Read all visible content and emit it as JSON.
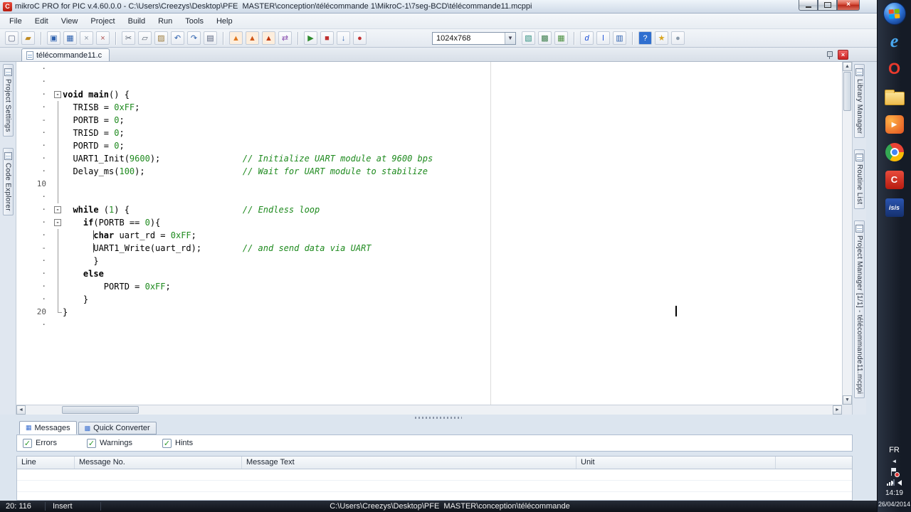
{
  "window": {
    "title": "mikroC PRO for PIC v.4.60.0.0 - C:\\Users\\Creezys\\Desktop\\PFE  MASTER\\conception\\télécommande 1\\MikroC-1\\7seg-BCD\\télécommande11.mcppi"
  },
  "menus": [
    "File",
    "Edit",
    "View",
    "Project",
    "Build",
    "Run",
    "Tools",
    "Help"
  ],
  "toolbar": {
    "resolution": "1024x768",
    "groups_left": [
      [
        {
          "name": "new-file",
          "glyph": "▢",
          "fg": "#55607a"
        },
        {
          "name": "open-file",
          "glyph": "▰",
          "fg": "#c08a20"
        }
      ],
      [
        {
          "name": "save-file",
          "glyph": "▣",
          "fg": "#2b5fad"
        },
        {
          "name": "save-all",
          "glyph": "▦",
          "fg": "#2b5fad"
        },
        {
          "name": "close-file",
          "glyph": "×",
          "fg": "#8a95a5"
        },
        {
          "name": "close-all",
          "glyph": "×",
          "fg": "#b05050"
        }
      ],
      [
        {
          "name": "cut",
          "glyph": "✂",
          "fg": "#555f6e"
        },
        {
          "name": "copy",
          "glyph": "▱",
          "fg": "#555f6e"
        },
        {
          "name": "paste",
          "glyph": "▨",
          "fg": "#9a7a3a"
        },
        {
          "name": "undo",
          "glyph": "↶",
          "fg": "#2b5fad"
        },
        {
          "name": "redo",
          "glyph": "↷",
          "fg": "#2b5fad"
        },
        {
          "name": "print",
          "glyph": "▤",
          "fg": "#55607a"
        }
      ],
      [
        {
          "name": "build",
          "glyph": "▲",
          "fg": "#e07820",
          "bg": "#fdeedd"
        },
        {
          "name": "rebuild",
          "glyph": "▲",
          "fg": "#d05818",
          "bg": "#fdeedd"
        },
        {
          "name": "build-and-program",
          "glyph": "▲",
          "fg": "#c03810",
          "bg": "#fdeedd"
        },
        {
          "name": "program",
          "glyph": "⇄",
          "fg": "#8a4fb0"
        }
      ],
      [
        {
          "name": "run-debugger",
          "glyph": "▶",
          "fg": "#2e8b2e"
        },
        {
          "name": "stop-debugger",
          "glyph": "■",
          "fg": "#c03030"
        },
        {
          "name": "step-into",
          "glyph": "↓",
          "fg": "#2b5fad"
        },
        {
          "name": "breakpoints",
          "glyph": "●",
          "fg": "#c03030"
        }
      ]
    ],
    "groups_right": [
      [
        {
          "name": "edit-project",
          "glyph": "▧",
          "fg": "#2f8f7f"
        },
        {
          "name": "clean-project",
          "glyph": "▩",
          "fg": "#3f7f4f"
        },
        {
          "name": "project-manager",
          "glyph": "▦",
          "fg": "#4a8f3f"
        }
      ],
      [
        {
          "name": "comment-lines",
          "glyph": "d",
          "fg": "#1b4fd8",
          "italic": true
        },
        {
          "name": "uncomment-lines",
          "glyph": "l",
          "fg": "#1b4fd8"
        },
        {
          "name": "code-templates",
          "glyph": "▥",
          "fg": "#2b5fad"
        }
      ],
      [
        {
          "name": "help",
          "glyph": "?",
          "fg": "#ffffff",
          "bg": "#2f6fd0"
        },
        {
          "name": "show-tips",
          "glyph": "★",
          "fg": "#d9a520"
        },
        {
          "name": "check-updates",
          "glyph": "●",
          "fg": "#8899aa"
        }
      ]
    ]
  },
  "document_tab": {
    "label": "télécommande11.c"
  },
  "side_left": [
    {
      "label": "Project Settings",
      "icon": "project-settings-icon"
    },
    {
      "label": "Code Explorer",
      "icon": "code-explorer-icon"
    }
  ],
  "side_right": [
    {
      "label": "Library Manager",
      "icon": "library-manager-icon"
    },
    {
      "label": "Routine List",
      "icon": "routine-list-icon"
    },
    {
      "label": "Project Manager [1/1] - télécommande11.mcppi",
      "icon": "project-manager-icon"
    }
  ],
  "editor": {
    "lines": [
      {
        "g": "·",
        "f": "",
        "t": []
      },
      {
        "g": "·",
        "f": "",
        "t": []
      },
      {
        "g": "·",
        "f": "box",
        "t": [
          {
            "c": "kw",
            "s": "void main"
          },
          {
            "c": "pl",
            "s": "() {"
          }
        ]
      },
      {
        "g": "·",
        "f": "ln",
        "t": [
          {
            "c": "pl",
            "s": "  TRISB = "
          },
          {
            "c": "num",
            "s": "0xFF"
          },
          {
            "c": "pl",
            "s": ";"
          }
        ]
      },
      {
        "g": "-",
        "f": "ln",
        "t": [
          {
            "c": "pl",
            "s": "  PORTB = "
          },
          {
            "c": "num",
            "s": "0"
          },
          {
            "c": "pl",
            "s": ";"
          }
        ]
      },
      {
        "g": "·",
        "f": "ln",
        "t": [
          {
            "c": "pl",
            "s": "  TRISD = "
          },
          {
            "c": "num",
            "s": "0"
          },
          {
            "c": "pl",
            "s": ";"
          }
        ]
      },
      {
        "g": "·",
        "f": "ln",
        "t": [
          {
            "c": "pl",
            "s": "  PORTD = "
          },
          {
            "c": "num",
            "s": "0"
          },
          {
            "c": "pl",
            "s": ";"
          }
        ]
      },
      {
        "g": "·",
        "f": "ln",
        "t": [
          {
            "c": "pl",
            "s": "  UART1_Init("
          },
          {
            "c": "num",
            "s": "9600"
          },
          {
            "c": "pl",
            "s": ");                "
          },
          {
            "c": "cm",
            "s": "// Initialize UART module at 9600 bps"
          }
        ]
      },
      {
        "g": "·",
        "f": "ln",
        "t": [
          {
            "c": "pl",
            "s": "  Delay_ms("
          },
          {
            "c": "num",
            "s": "100"
          },
          {
            "c": "pl",
            "s": ");                   "
          },
          {
            "c": "cm",
            "s": "// Wait for UART module to stabilize"
          }
        ]
      },
      {
        "g": "10",
        "f": "ln",
        "t": []
      },
      {
        "g": "·",
        "f": "ln",
        "t": []
      },
      {
        "g": "·",
        "f": "box",
        "t": [
          {
            "c": "pl",
            "s": "  "
          },
          {
            "c": "kw",
            "s": "while"
          },
          {
            "c": "pl",
            "s": " ("
          },
          {
            "c": "num",
            "s": "1"
          },
          {
            "c": "pl",
            "s": ") {                      "
          },
          {
            "c": "cm",
            "s": "// Endless loop"
          }
        ]
      },
      {
        "g": "·",
        "f": "box",
        "t": [
          {
            "c": "pl",
            "s": "    "
          },
          {
            "c": "kw",
            "s": "if"
          },
          {
            "c": "pl",
            "s": "(PORTB == "
          },
          {
            "c": "num",
            "s": "0"
          },
          {
            "c": "pl",
            "s": "){"
          }
        ]
      },
      {
        "g": "·",
        "f": "ln",
        "t": [
          {
            "c": "pl",
            "s": "      "
          },
          {
            "c": "gd",
            "s": ""
          },
          {
            "c": "kw",
            "s": "char"
          },
          {
            "c": "pl",
            "s": " uart_rd = "
          },
          {
            "c": "num",
            "s": "0xFF"
          },
          {
            "c": "pl",
            "s": ";"
          }
        ]
      },
      {
        "g": "-",
        "f": "ln",
        "t": [
          {
            "c": "pl",
            "s": "      "
          },
          {
            "c": "gd",
            "s": ""
          },
          {
            "c": "pl",
            "s": "UART1_Write(uart_rd);        "
          },
          {
            "c": "cm",
            "s": "// and send data via UART"
          }
        ]
      },
      {
        "g": "·",
        "f": "ln",
        "t": [
          {
            "c": "pl",
            "s": "      }"
          }
        ]
      },
      {
        "g": "·",
        "f": "ln",
        "t": [
          {
            "c": "pl",
            "s": "    "
          },
          {
            "c": "kw",
            "s": "else"
          }
        ]
      },
      {
        "g": "·",
        "f": "ln",
        "t": [
          {
            "c": "pl",
            "s": "        PORTD = "
          },
          {
            "c": "num",
            "s": "0xFF"
          },
          {
            "c": "pl",
            "s": ";"
          }
        ]
      },
      {
        "g": "·",
        "f": "ln",
        "t": [
          {
            "c": "pl",
            "s": "    }"
          }
        ]
      },
      {
        "g": "20",
        "f": "end",
        "t": [
          {
            "c": "pl",
            "s": "}"
          }
        ]
      },
      {
        "g": "·",
        "f": "",
        "t": []
      }
    ]
  },
  "bottom": {
    "tabs": [
      {
        "label": "Messages",
        "icon": "▦",
        "active": true
      },
      {
        "label": "Quick Converter",
        "icon": "▩",
        "active": false
      }
    ],
    "filters": [
      {
        "label": "Errors",
        "checked": true
      },
      {
        "label": "Warnings",
        "checked": true
      },
      {
        "label": "Hints",
        "checked": true
      }
    ],
    "columns": [
      "Line",
      "Message No.",
      "Message Text",
      "Unit"
    ]
  },
  "statusbar": {
    "caret": "20: 116",
    "mode": "Insert",
    "path": "C:\\Users\\Creezys\\Desktop\\PFE  MASTER\\conception\\télécommande"
  },
  "taskbar": {
    "items": [
      {
        "name": "start-button"
      },
      {
        "name": "internet-explorer",
        "glyph": "e"
      },
      {
        "name": "opera",
        "glyph": "O"
      },
      {
        "name": "folder"
      },
      {
        "name": "media-player",
        "glyph": "▶"
      },
      {
        "name": "chrome"
      },
      {
        "name": "mikroc",
        "glyph": "C"
      },
      {
        "name": "isis",
        "glyph": "isis"
      }
    ],
    "language": "FR",
    "time": "14:19",
    "date": "26/04/2014"
  }
}
